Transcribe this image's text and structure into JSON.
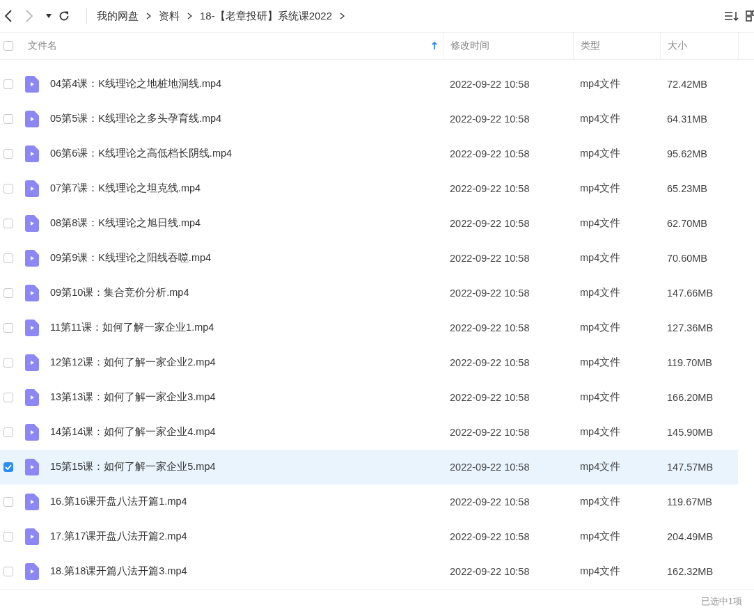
{
  "toolbar": {
    "breadcrumb": [
      "我的网盘",
      "资料",
      "18-【老章投研】系统课2022"
    ]
  },
  "table": {
    "header_checked": false,
    "columns": [
      {
        "label": "文件名",
        "sorted": true
      },
      {
        "label": "修改时间",
        "sorted": false
      },
      {
        "label": "类型",
        "sorted": false
      },
      {
        "label": "大小",
        "sorted": false
      }
    ],
    "rows": [
      {
        "name": "04第4课：K线理论之地桩地洞线.mp4",
        "modified": "2022-09-22 10:58",
        "type": "mp4文件",
        "size": "72.42MB",
        "selected": false
      },
      {
        "name": "05第5课：K线理论之多头孕育线.mp4",
        "modified": "2022-09-22 10:58",
        "type": "mp4文件",
        "size": "64.31MB",
        "selected": false
      },
      {
        "name": "06第6课：K线理论之高低档长阴线.mp4",
        "modified": "2022-09-22 10:58",
        "type": "mp4文件",
        "size": "95.62MB",
        "selected": false
      },
      {
        "name": "07第7课：K线理论之坦克线.mp4",
        "modified": "2022-09-22 10:58",
        "type": "mp4文件",
        "size": "65.23MB",
        "selected": false
      },
      {
        "name": "08第8课：K线理论之旭日线.mp4",
        "modified": "2022-09-22 10:58",
        "type": "mp4文件",
        "size": "62.70MB",
        "selected": false
      },
      {
        "name": "09第9课：K线理论之阳线吞噬.mp4",
        "modified": "2022-09-22 10:58",
        "type": "mp4文件",
        "size": "70.60MB",
        "selected": false
      },
      {
        "name": "09第10课：集合竞价分析.mp4",
        "modified": "2022-09-22 10:58",
        "type": "mp4文件",
        "size": "147.66MB",
        "selected": false
      },
      {
        "name": "11第11课：如何了解一家企业1.mp4",
        "modified": "2022-09-22 10:58",
        "type": "mp4文件",
        "size": "127.36MB",
        "selected": false
      },
      {
        "name": "12第12课：如何了解一家企业2.mp4",
        "modified": "2022-09-22 10:58",
        "type": "mp4文件",
        "size": "119.70MB",
        "selected": false
      },
      {
        "name": "13第13课：如何了解一家企业3.mp4",
        "modified": "2022-09-22 10:58",
        "type": "mp4文件",
        "size": "166.20MB",
        "selected": false
      },
      {
        "name": "14第14课：如何了解一家企业4.mp4",
        "modified": "2022-09-22 10:58",
        "type": "mp4文件",
        "size": "145.90MB",
        "selected": false
      },
      {
        "name": "15第15课：如何了解一家企业5.mp4",
        "modified": "2022-09-22 10:58",
        "type": "mp4文件",
        "size": "147.57MB",
        "selected": true
      },
      {
        "name": "16.第16课开盘八法开篇1.mp4",
        "modified": "2022-09-22 10:58",
        "type": "mp4文件",
        "size": "119.67MB",
        "selected": false
      },
      {
        "name": "17.第17课开盘八法开篇2.mp4",
        "modified": "2022-09-22 10:58",
        "type": "mp4文件",
        "size": "204.49MB",
        "selected": false
      },
      {
        "name": "18.第18课开篇八法开篇3.mp4",
        "modified": "2022-09-22 10:58",
        "type": "mp4文件",
        "size": "162.32MB",
        "selected": false
      }
    ]
  },
  "status_bar": {
    "text": "已选中1项"
  }
}
